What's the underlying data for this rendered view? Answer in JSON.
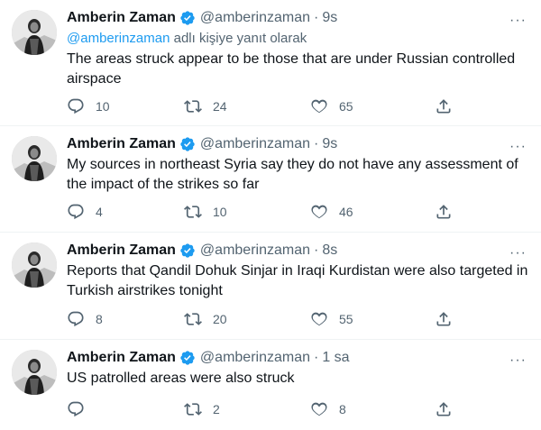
{
  "tweets": [
    {
      "name": "Amberin Zaman",
      "handle": "@amberinzaman",
      "time": "9s",
      "reply_to": {
        "mention": "@amberinzaman",
        "suffix": " adlı kişiye yanıt olarak"
      },
      "text": "The areas struck appear to be those that are under Russian controlled airspace",
      "replies": "10",
      "retweets": "24",
      "likes": "65"
    },
    {
      "name": "Amberin Zaman",
      "handle": "@amberinzaman",
      "time": "9s",
      "text": "My sources in northeast Syria say they do not have any assessment of the impact of the strikes so far",
      "replies": "4",
      "retweets": "10",
      "likes": "46"
    },
    {
      "name": "Amberin Zaman",
      "handle": "@amberinzaman",
      "time": "8s",
      "text": "Reports that Qandil Dohuk Sinjar in Iraqi Kurdistan were also targeted in Turkish airstrikes tonight",
      "replies": "8",
      "retweets": "20",
      "likes": "55"
    },
    {
      "name": "Amberin Zaman",
      "handle": "@amberinzaman",
      "time": "1 sa",
      "text": "US patrolled areas were also struck",
      "replies": "",
      "retweets": "2",
      "likes": "8"
    }
  ],
  "separator": "·",
  "more_glyph": "···",
  "colors": {
    "accent": "#1d9bf0",
    "muted": "#536471",
    "text": "#0f1419",
    "divider": "#eff3f4"
  },
  "icons": [
    "verified-badge-icon",
    "more-icon",
    "reply-icon",
    "retweet-icon",
    "like-icon",
    "share-icon"
  ]
}
